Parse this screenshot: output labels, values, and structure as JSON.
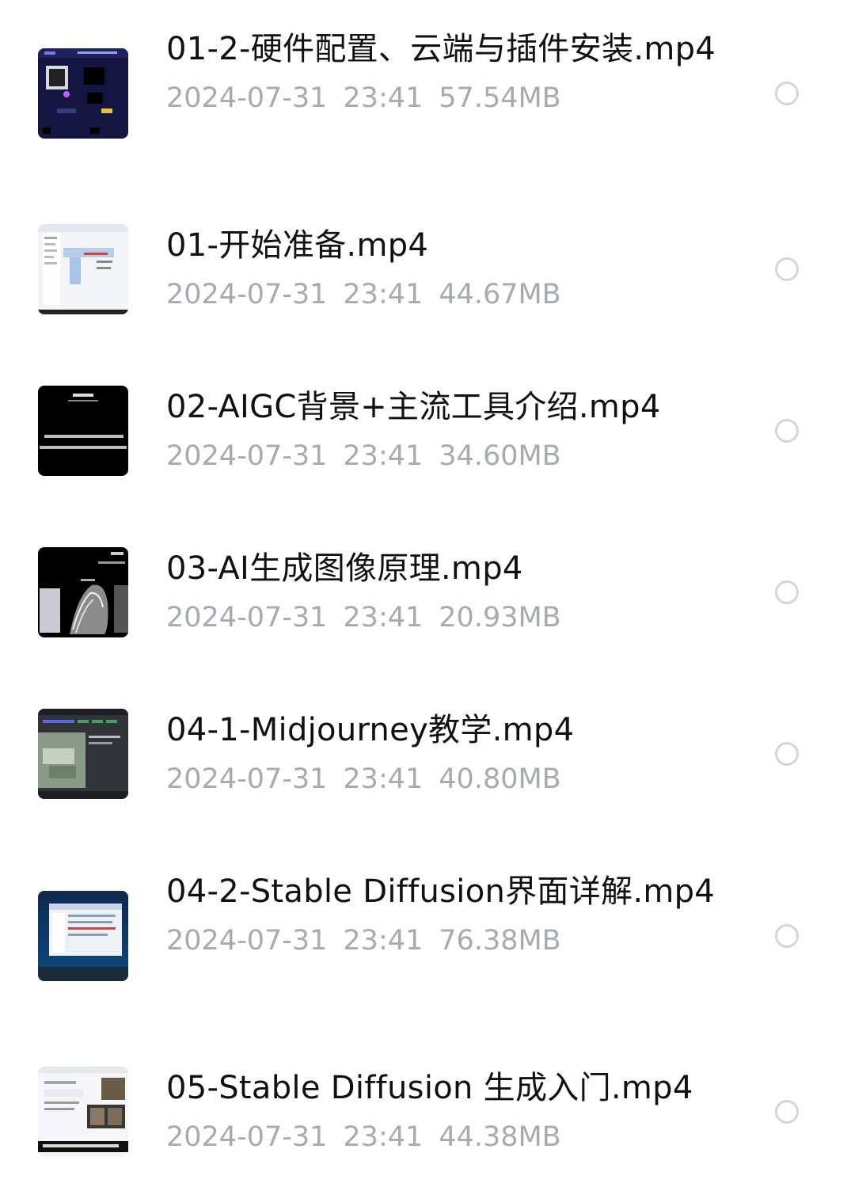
{
  "files": [
    {
      "name": "01-2-硬件配置、云端与插件安装.mp4",
      "date": "2024-07-31",
      "time": "23:41",
      "size": "57.54MB",
      "thumbnail": "dark-hardware-slide"
    },
    {
      "name": "01-开始准备.mp4",
      "date": "2024-07-31",
      "time": "23:41",
      "size": "44.67MB",
      "thumbnail": "file-explorer-screenshot"
    },
    {
      "name": "02-AIGC背景+主流工具介绍.mp4",
      "date": "2024-07-31",
      "time": "23:41",
      "size": "34.60MB",
      "thumbnail": "black-text-slide"
    },
    {
      "name": "03-AI生成图像原理.mp4",
      "date": "2024-07-31",
      "time": "23:41",
      "size": "20.93MB",
      "thumbnail": "black-image-slide"
    },
    {
      "name": "04-1-Midjourney教学.mp4",
      "date": "2024-07-31",
      "time": "23:41",
      "size": "40.80MB",
      "thumbnail": "discord-screenshot"
    },
    {
      "name": "04-2-Stable Diffusion界面详解.mp4",
      "date": "2024-07-31",
      "time": "23:41",
      "size": "76.38MB",
      "thumbnail": "dark-blue-desktop"
    },
    {
      "name": "05-Stable Diffusion 生成入门.mp4",
      "date": "2024-07-31",
      "time": "23:41",
      "size": "44.38MB",
      "thumbnail": "webui-screenshot"
    }
  ]
}
